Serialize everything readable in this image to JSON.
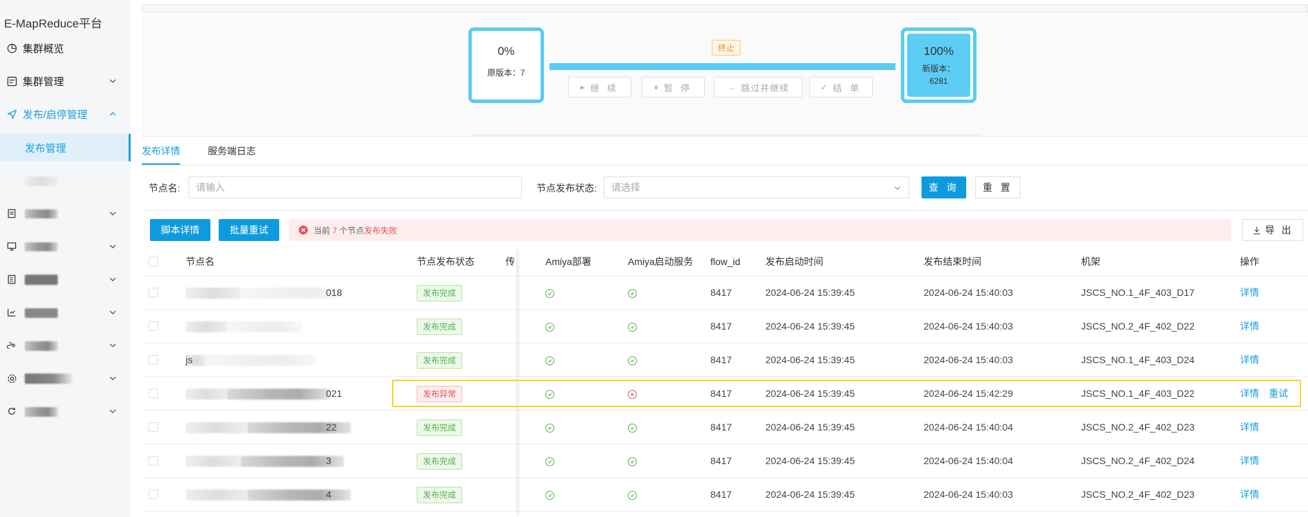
{
  "sidebar": {
    "brand": "E-MapReduce平台",
    "items": [
      {
        "label": "集群概览",
        "icon": "pie-chart-icon"
      },
      {
        "label": "集群管理",
        "icon": "cluster-icon"
      },
      {
        "label": "发布/启停管理",
        "icon": "send-icon"
      },
      {
        "label": "发布管理"
      }
    ]
  },
  "progress": {
    "old_percent": "0%",
    "old_version_label": "原版本：7",
    "new_percent": "100%",
    "new_version_label": "新版本：",
    "new_version_value": "6281",
    "status_badge": "终止",
    "buttons": [
      "继 续",
      "暂 停",
      "跳过并继续",
      "结 单"
    ]
  },
  "tabs": [
    "发布详情",
    "服务端日志"
  ],
  "filters": {
    "node_name_label": "节点名:",
    "node_name_placeholder": "请输入",
    "status_label": "节点发布状态:",
    "status_placeholder": "请选择",
    "query_button": "查 询",
    "reset_button": "重 置"
  },
  "actions": {
    "script_detail": "脚本详情",
    "batch_retry": "批量重试",
    "alert_prefix": "当前",
    "alert_count": "7",
    "alert_middle": "个节点",
    "alert_suffix": "发布失败",
    "export_button": "导 出"
  },
  "table": {
    "headers": [
      "节点名",
      "节点发布状态",
      "传",
      "Amiya部署",
      "Amiya启动服务",
      "flow_id",
      "发布启动时间",
      "发布结束时间",
      "机架",
      "操作"
    ],
    "rows": [
      {
        "node": "018",
        "status": "发布完成",
        "status_type": "ok",
        "deploy_ok": true,
        "start_ok": true,
        "flow_id": "8417",
        "start": "2024-06-24 15:39:45",
        "end": "2024-06-24 15:40:03",
        "rack": "JSCS_NO.1_4F_403_D17",
        "ops": [
          "详情"
        ]
      },
      {
        "node": "",
        "status": "发布完成",
        "status_type": "ok",
        "deploy_ok": true,
        "start_ok": true,
        "flow_id": "8417",
        "start": "2024-06-24 15:39:45",
        "end": "2024-06-24 15:40:03",
        "rack": "JSCS_NO.2_4F_402_D22",
        "ops": [
          "详情"
        ]
      },
      {
        "node": "js",
        "status": "发布完成",
        "status_type": "ok",
        "deploy_ok": true,
        "start_ok": true,
        "flow_id": "8417",
        "start": "2024-06-24 15:39:45",
        "end": "2024-06-24 15:40:03",
        "rack": "JSCS_NO.1_4F_403_D24",
        "ops": [
          "详情"
        ]
      },
      {
        "node": "021",
        "status": "发布异常",
        "status_type": "err",
        "deploy_ok": true,
        "start_ok": false,
        "flow_id": "8417",
        "start": "2024-06-24 15:39:45",
        "end": "2024-06-24 15:42:29",
        "rack": "JSCS_NO.1_4F_403_D22",
        "ops": [
          "详情",
          "重试"
        ]
      },
      {
        "node": "22",
        "status": "发布完成",
        "status_type": "ok",
        "deploy_ok": true,
        "start_ok": true,
        "flow_id": "8417",
        "start": "2024-06-24 15:39:45",
        "end": "2024-06-24 15:40:04",
        "rack": "JSCS_NO.2_4F_402_D23",
        "ops": [
          "详情"
        ]
      },
      {
        "node": "3",
        "status": "发布完成",
        "status_type": "ok",
        "deploy_ok": true,
        "start_ok": true,
        "flow_id": "8417",
        "start": "2024-06-24 15:39:45",
        "end": "2024-06-24 15:40:04",
        "rack": "JSCS_NO.2_4F_402_D24",
        "ops": [
          "详情"
        ]
      },
      {
        "node": "4",
        "status": "发布完成",
        "status_type": "ok",
        "deploy_ok": true,
        "start_ok": true,
        "flow_id": "8417",
        "start": "2024-06-24 15:39:45",
        "end": "2024-06-24 15:40:03",
        "rack": "JSCS_NO.2_4F_402_D23",
        "ops": [
          "详情"
        ]
      }
    ]
  },
  "colors": {
    "accent": "#1a9fe0",
    "progress": "#59ccf2",
    "success": "#52b44b",
    "error": "#e55353",
    "highlight": "#f5d32a"
  }
}
